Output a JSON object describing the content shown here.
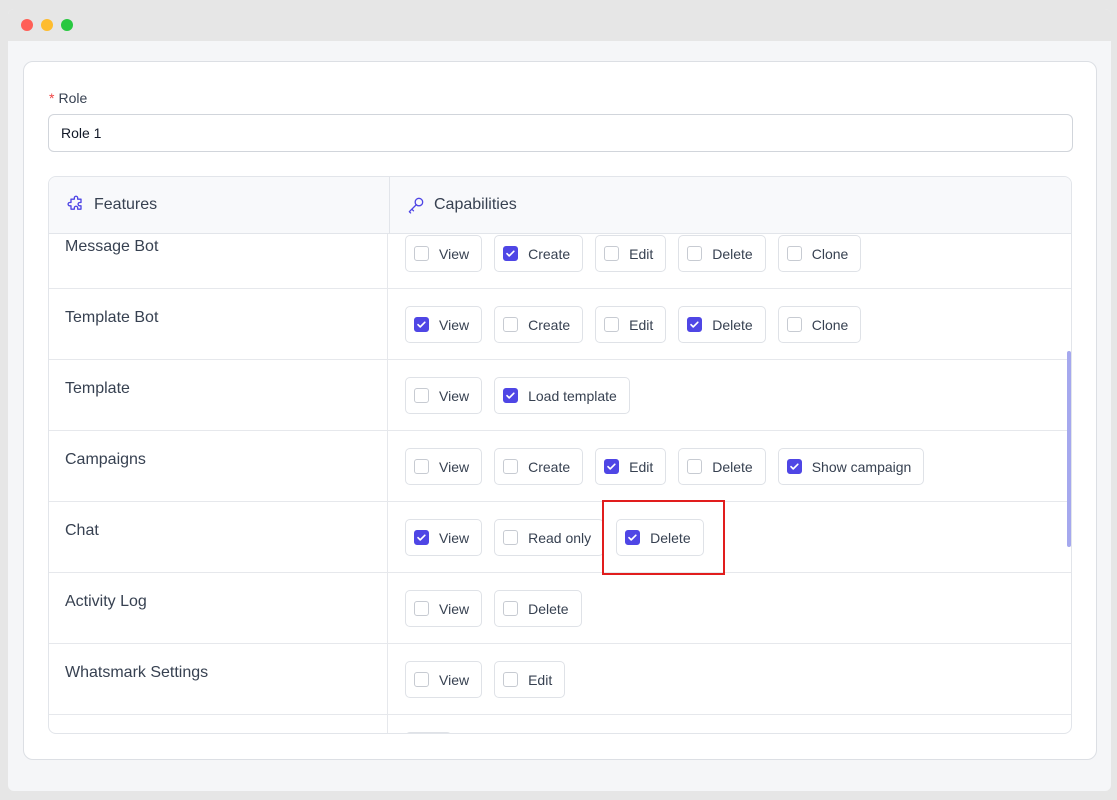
{
  "form": {
    "role_label": "Role",
    "required_mark": "*",
    "role_value": "Role 1"
  },
  "table": {
    "features_header": "Features",
    "capabilities_header": "Capabilities",
    "rows": [
      {
        "name": "Message Bot",
        "caps": [
          {
            "label": "View",
            "checked": false
          },
          {
            "label": "Create",
            "checked": true
          },
          {
            "label": "Edit",
            "checked": false
          },
          {
            "label": "Delete",
            "checked": false
          },
          {
            "label": "Clone",
            "checked": false
          }
        ]
      },
      {
        "name": "Template Bot",
        "caps": [
          {
            "label": "View",
            "checked": true
          },
          {
            "label": "Create",
            "checked": false
          },
          {
            "label": "Edit",
            "checked": false
          },
          {
            "label": "Delete",
            "checked": true
          },
          {
            "label": "Clone",
            "checked": false
          }
        ]
      },
      {
        "name": "Template",
        "caps": [
          {
            "label": "View",
            "checked": false
          },
          {
            "label": "Load template",
            "checked": true
          }
        ]
      },
      {
        "name": "Campaigns",
        "caps": [
          {
            "label": "View",
            "checked": false
          },
          {
            "label": "Create",
            "checked": false
          },
          {
            "label": "Edit",
            "checked": true
          },
          {
            "label": "Delete",
            "checked": false
          },
          {
            "label": "Show campaign",
            "checked": true
          }
        ]
      },
      {
        "name": "Chat",
        "caps": [
          {
            "label": "View",
            "checked": true
          },
          {
            "label": "Read only",
            "checked": false
          },
          {
            "label": "Delete",
            "checked": true
          }
        ]
      },
      {
        "name": "Activity Log",
        "caps": [
          {
            "label": "View",
            "checked": false
          },
          {
            "label": "Delete",
            "checked": false
          }
        ]
      },
      {
        "name": "Whatsmark Settings",
        "caps": [
          {
            "label": "View",
            "checked": false
          },
          {
            "label": "Edit",
            "checked": false
          }
        ]
      },
      {
        "name": "",
        "caps": [
          {
            "label": "",
            "checked": false
          }
        ]
      }
    ]
  },
  "colors": {
    "accent": "#4f46e5",
    "highlight": "#e11d1d",
    "scrollbar": "#a5a8ee"
  },
  "icons": [
    "puzzle-icon",
    "key-icon",
    "check-icon"
  ]
}
